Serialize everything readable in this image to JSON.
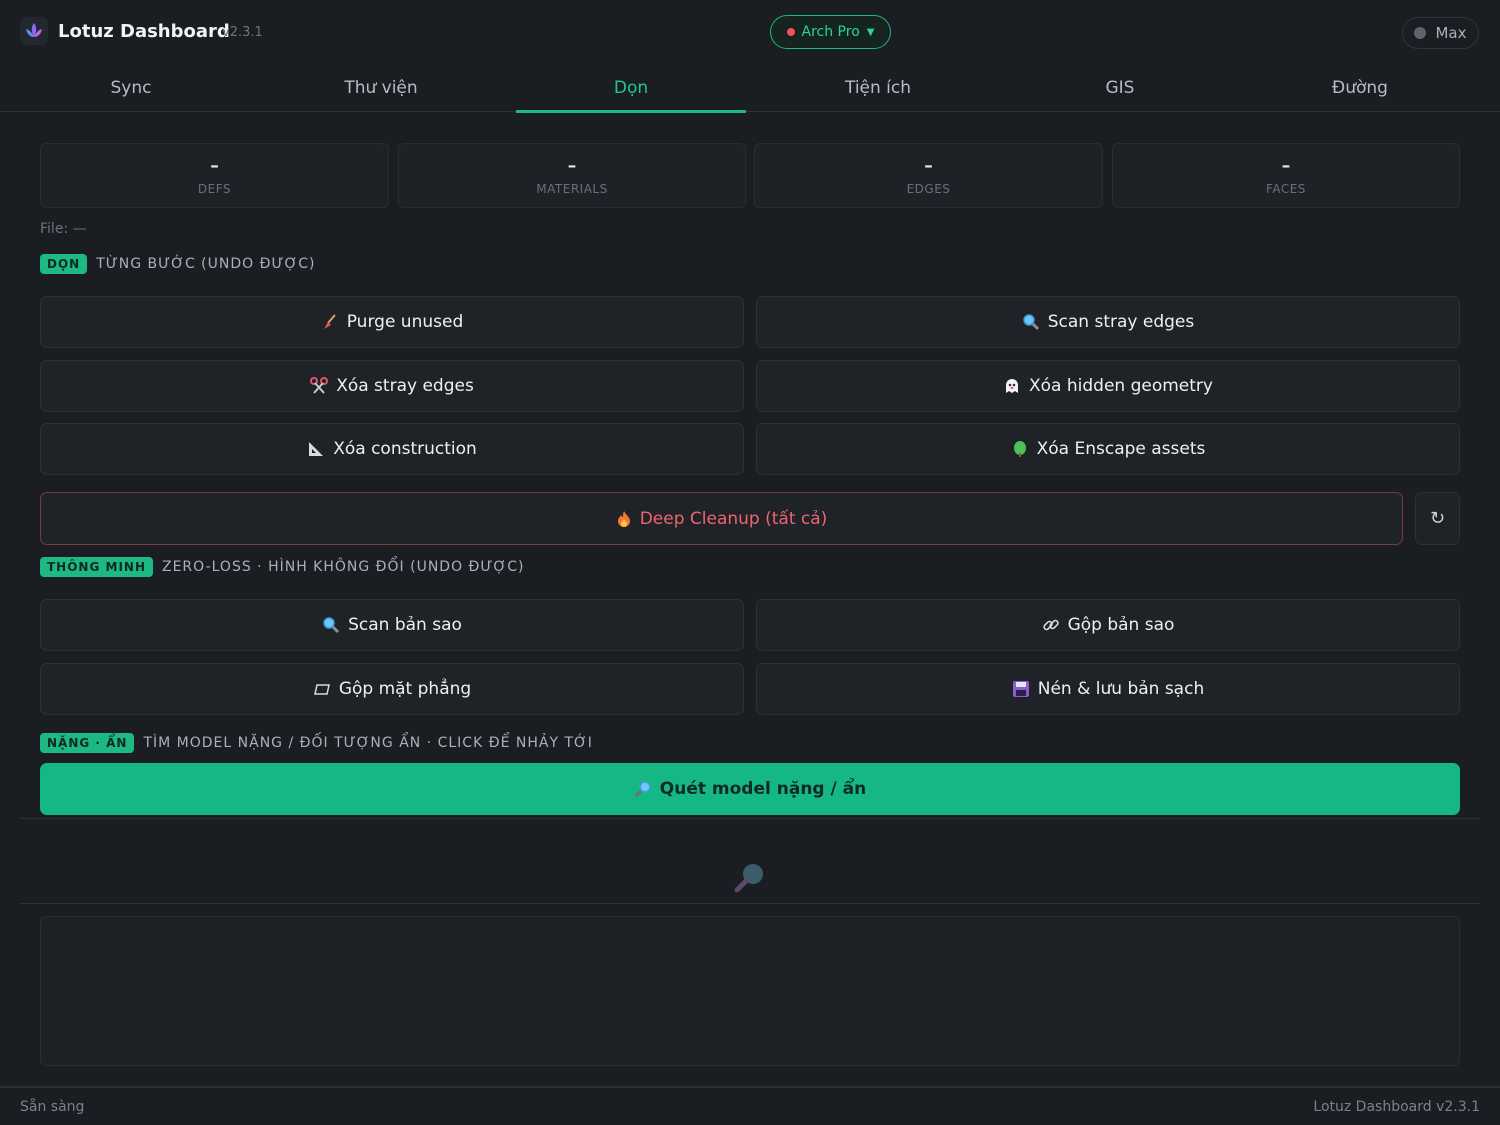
{
  "header": {
    "title": "Lotuz Dashboard",
    "version": "v2.3.1",
    "profile": "Arch Pro",
    "user": "Max",
    "logo_icon": "lotus-icon"
  },
  "tabs": [
    {
      "label": "Sync",
      "active": false
    },
    {
      "label": "Thư viện",
      "active": false
    },
    {
      "label": "Dọn",
      "active": true
    },
    {
      "label": "Tiện ích",
      "active": false
    },
    {
      "label": "GIS",
      "active": false
    },
    {
      "label": "Đường",
      "active": false
    }
  ],
  "stats": [
    {
      "value": "–",
      "label": "DEFS"
    },
    {
      "value": "–",
      "label": "MATERIALS"
    },
    {
      "value": "–",
      "label": "EDGES"
    },
    {
      "value": "–",
      "label": "FACES"
    }
  ],
  "file_line": "File: —",
  "sections": {
    "cleanup": {
      "badge": "DỌN",
      "description": "TỪNG BƯỚC (UNDO ĐƯỢC)"
    },
    "smart": {
      "badge": "THÔNG MINH",
      "description": "ZERO-LOSS · HÌNH KHÔNG ĐỔI (UNDO ĐƯỢC)"
    },
    "heavy": {
      "badge": "NẶNG · ẨN",
      "description": "TÌM MODEL NẶNG / ĐỐI TƯỢNG ẨN · CLICK ĐỂ NHẢY TỚI"
    }
  },
  "cleanup_buttons": [
    {
      "label": "Purge unused",
      "icon": "broom-icon"
    },
    {
      "label": "Scan stray edges",
      "icon": "magnifier-icon"
    },
    {
      "label": "Xóa stray edges",
      "icon": "scissors-icon"
    },
    {
      "label": "Xóa hidden geometry",
      "icon": "ghost-icon"
    },
    {
      "label": "Xóa construction",
      "icon": "triangle-ruler-icon"
    },
    {
      "label": "Xóa Enscape assets",
      "icon": "tree-icon"
    }
  ],
  "deep_cleanup": {
    "label": "Deep Cleanup (tất cả)",
    "icon": "fire-icon",
    "refresh_glyph": "↻"
  },
  "smart_buttons": [
    {
      "label": "Scan bản sao",
      "icon": "magnifier-icon"
    },
    {
      "label": "Gộp bản sao",
      "icon": "link-icon"
    },
    {
      "label": "Gộp mặt phẳng",
      "icon": "plane-icon"
    },
    {
      "label": "Nén & lưu bản sạch",
      "icon": "floppy-disk-icon"
    }
  ],
  "heavy_scan": {
    "label": "Quét model nặng / ẩn",
    "icon": "magnifier-right-icon"
  },
  "status": {
    "left": "Sẵn sàng",
    "right": "Lotuz Dashboard v2.3.1"
  },
  "colors": {
    "background": "#1a1d21",
    "accent": "#1db884",
    "danger": "#f0646e",
    "profile_dot": "#ef4f5f"
  }
}
